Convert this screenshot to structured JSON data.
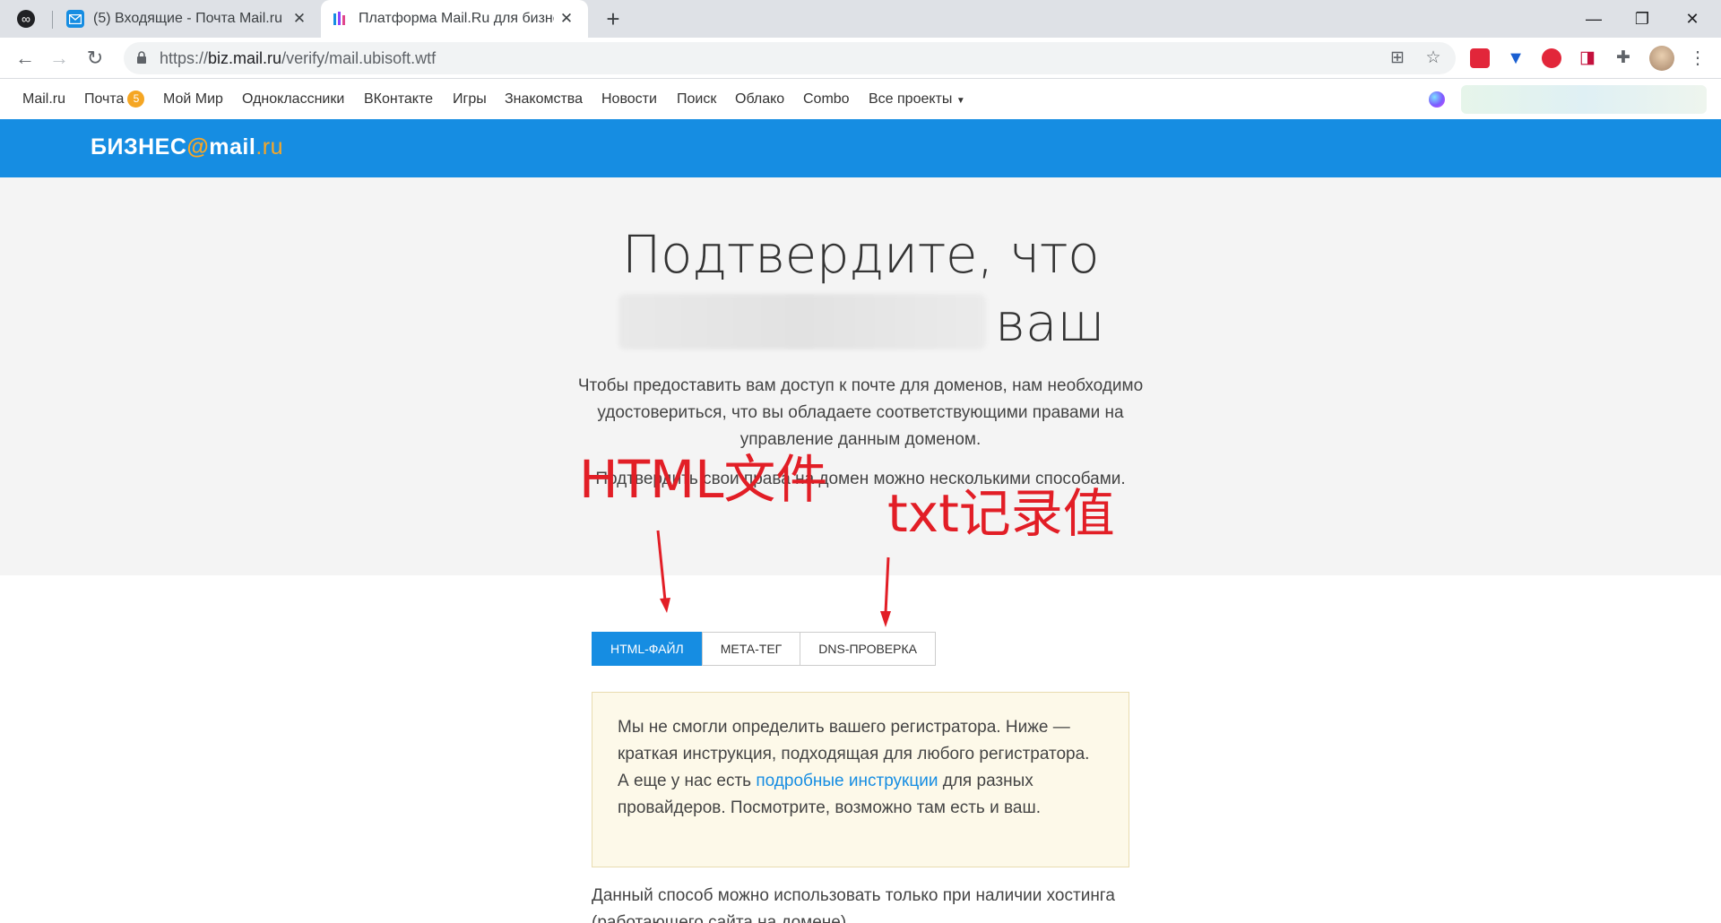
{
  "browser": {
    "tabs": [
      {
        "title": "(5) Входящие - Почта Mail.ru"
      },
      {
        "title": "Платформа Mail.Ru для бизнеса"
      }
    ],
    "address": {
      "scheme": "https://",
      "host": "biz.mail.ru",
      "path": "/verify/mail.ubisoft.wtf"
    },
    "icons": [
      "back-icon",
      "forward-icon",
      "reload-icon",
      "lock-icon",
      "translate-icon",
      "star-icon",
      "extensions-icon",
      "menu-icon"
    ]
  },
  "portal": {
    "links": [
      "Mail.ru",
      "Почта",
      "Мой Мир",
      "Одноклассники",
      "ВКонтакте",
      "Игры",
      "Знакомства",
      "Новости",
      "Поиск",
      "Облако",
      "Combo",
      "Все проекты"
    ],
    "mail_badge": "5"
  },
  "header": {
    "logo_part1": "БИЗНЕС",
    "logo_at": "@",
    "logo_part2": "mail",
    "logo_part3": ".ru"
  },
  "hero": {
    "title_line1": "Подтвердите, что",
    "title_word": "ваш",
    "description": "Чтобы предоставить вам доступ к почте для доменов, нам необходимо удостовериться, что вы обладаете соответствующими правами на управление данным доменом.",
    "description2": "Подтвердить свои права на домен можно несколькими способами."
  },
  "annotations": {
    "html_file": "HTML文件",
    "txt_record": "txt记录值"
  },
  "methods": [
    "HTML-файл",
    "Мета-тег",
    "DNS-проверка"
  ],
  "notice": {
    "text_before": "Мы не смогли определить вашего регистратора. Ниже — краткая инструкция, подходящая для любого регистратора. А еще у нас есть ",
    "link": "подробные инструкции",
    "text_after": " для разных провайдеров. Посмотрите, возможно там есть и ваш."
  },
  "bottom_text": "Данный способ можно использовать только при наличии хостинга (работающего сайта на домене)",
  "colors": {
    "brand_blue": "#168de2",
    "brand_orange": "#f8a726",
    "annotation_red": "#e21e26"
  }
}
